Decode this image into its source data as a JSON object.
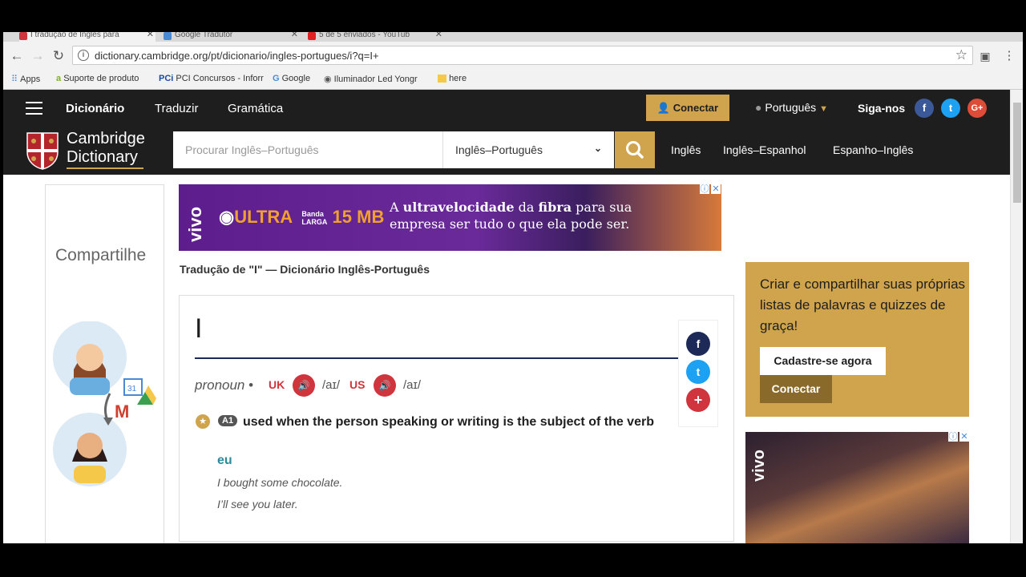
{
  "browser": {
    "tabs": [
      {
        "title": "I tradução de Inglês para",
        "icon_color": "#d0343d"
      },
      {
        "title": "Google Tradutor",
        "icon_color": "#4a8ad4"
      },
      {
        "title": "5 de 5 enviados - YouTub",
        "icon_color": "#e02020"
      }
    ],
    "url": "dictionary.cambridge.org/pt/dicionario/ingles-portugues/i?q=I+",
    "bookmarks": [
      "Apps",
      "Suporte de produto",
      "PCI Concursos - Inforr",
      "Google",
      "Iluminador Led Yongr",
      "here"
    ]
  },
  "topnav": {
    "links": [
      "Dicionário",
      "Traduzir",
      "Gramática"
    ],
    "connect": "Conectar",
    "language": "Português",
    "follow": "Siga-nos"
  },
  "search": {
    "logo_line1": "Cambridge",
    "logo_line2": "Dictionary",
    "placeholder": "Procurar Inglês–Português",
    "selected_dictionary": "Inglês–Português",
    "dict_links": [
      "Inglês",
      "Inglês–Espanhol",
      "Espanho–Inglês"
    ]
  },
  "share_panel": {
    "title": "Compartilhe"
  },
  "ad_banner": {
    "brand": "vivo",
    "product": "ULTRA",
    "speed_prefix_1": "Banda",
    "speed_prefix_2": "LARGA",
    "speed": "15 MB",
    "text_line1_a": "A ",
    "text_line1_b": "ultravelocidade",
    "text_line1_c": " da ",
    "text_line1_d": "fibra",
    "text_line1_e": " para sua",
    "text_line2": "empresa ser tudo o que ela pode ser."
  },
  "page_title": "Tradução de \"I\" — Dicionário Inglês-Português",
  "entry": {
    "headword": "I",
    "pos": "pronoun",
    "uk_label": "UK",
    "uk_ipa": "/aɪ/",
    "us_label": "US",
    "us_ipa": "/aɪ/",
    "level": "A1",
    "definition": "used when the person speaking or writing is the subject of the verb",
    "translation": "eu",
    "examples": [
      "I bought some chocolate.",
      "I’ll see you later."
    ]
  },
  "promo": {
    "text": "Criar e compartilhar suas próprias listas de palavras e quizzes de graça!",
    "signup": "Cadastre-se agora",
    "login": "Conectar"
  },
  "ad2": {
    "brand": "vivo"
  },
  "colors": {
    "nav_bg": "#1e1e1e",
    "gold": "#d0a44c",
    "red": "#d0343d",
    "navy": "#1d2a57",
    "teal": "#2d8a9a",
    "ad_purple": "#5d1d8c"
  }
}
